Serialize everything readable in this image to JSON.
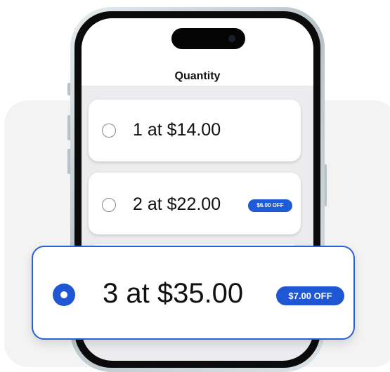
{
  "header": {
    "title": "Quantity"
  },
  "options": [
    {
      "label": "1 at $14.00",
      "selected": false,
      "badge": ""
    },
    {
      "label": "2 at $22.00",
      "selected": false,
      "badge": "$6.00 OFF"
    },
    {
      "label": "3 at $35.00",
      "selected": true,
      "badge": "$7.00 OFF"
    }
  ],
  "colors": {
    "accent": "#1e56d4",
    "background_card": "#f3f3f4",
    "screen_background": "#ececee",
    "phone_frame": "#b7c3c8"
  },
  "icons": {
    "radio_unselected": "radio-unselected-icon",
    "radio_selected": "radio-selected-icon"
  }
}
